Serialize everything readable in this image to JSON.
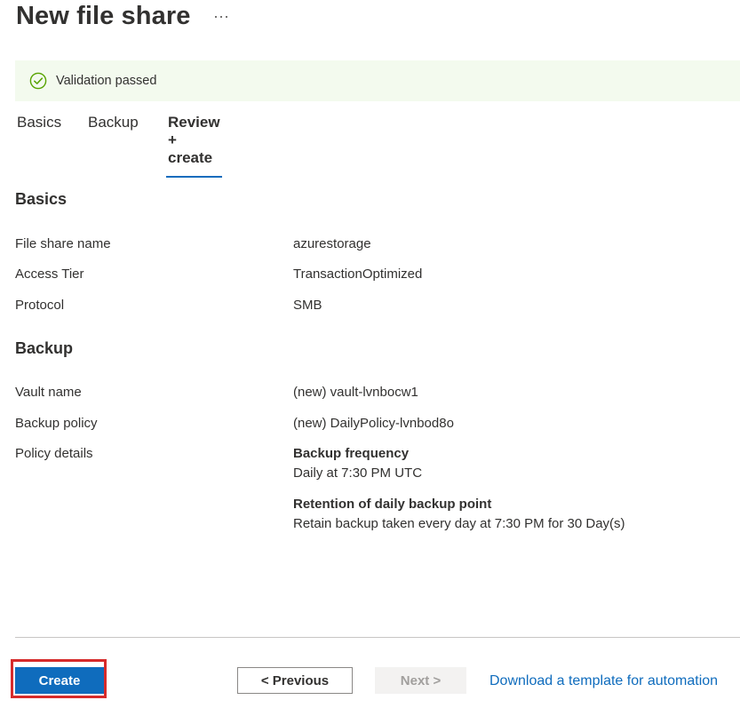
{
  "header": {
    "title": "New file share",
    "more_label": "···"
  },
  "banner": {
    "icon": "check-circle-icon",
    "message": "Validation passed",
    "color": "#f3faee",
    "icon_color": "#57a300"
  },
  "tabs": [
    {
      "label": "Basics",
      "active": false
    },
    {
      "label": "Backup",
      "active": false
    },
    {
      "label": "Review + create",
      "active": true
    }
  ],
  "sections": {
    "basics": {
      "heading": "Basics",
      "rows": [
        {
          "label": "File share name",
          "value": "azurestorage"
        },
        {
          "label": "Access Tier",
          "value": "TransactionOptimized"
        },
        {
          "label": "Protocol",
          "value": "SMB"
        }
      ]
    },
    "backup": {
      "heading": "Backup",
      "rows": [
        {
          "label": "Vault name",
          "value": "(new) vault-lvnbocw1"
        },
        {
          "label": "Backup policy",
          "value": "(new) DailyPolicy-lvnbod8o"
        }
      ],
      "policy_details": {
        "label": "Policy details",
        "frequency_heading": "Backup frequency",
        "frequency_value": "Daily at 7:30 PM UTC",
        "retention_heading": "Retention of daily backup point",
        "retention_value": "Retain backup taken every day at 7:30 PM for 30 Day(s)"
      }
    }
  },
  "footer": {
    "create_label": "Create",
    "previous_label": "< Previous",
    "next_label": "Next >",
    "download_link": "Download a template for automation"
  },
  "colors": {
    "accent": "#0f6cbd",
    "highlight_border": "#d62b2b"
  }
}
